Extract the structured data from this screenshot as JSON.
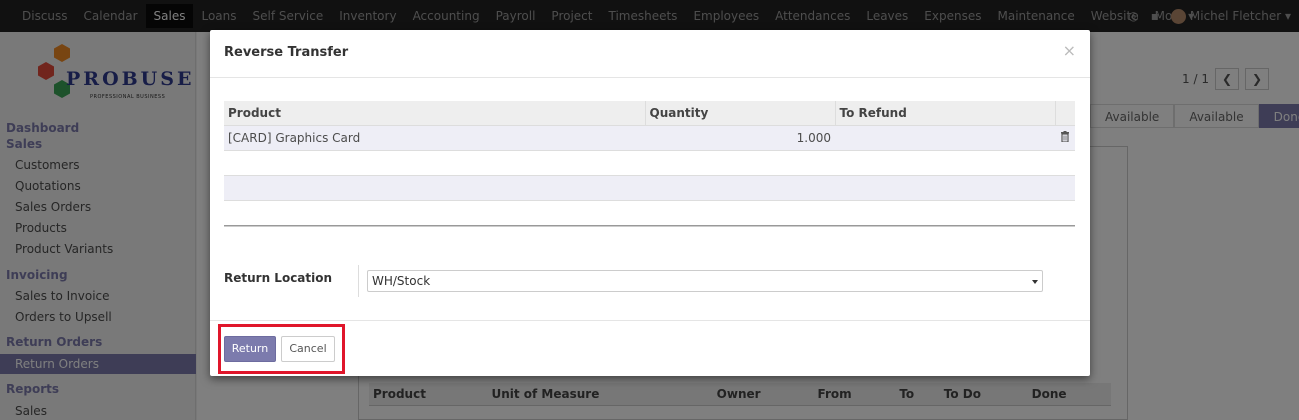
{
  "topbar": {
    "menu": [
      "Discuss",
      "Calendar",
      "Sales",
      "Loans",
      "Self Service",
      "Inventory",
      "Accounting",
      "Payroll",
      "Project",
      "Timesheets",
      "Employees",
      "Attendances",
      "Leaves",
      "Expenses",
      "Maintenance",
      "Website",
      "More ▾"
    ],
    "active": "Sales",
    "user": "Michel Fletcher ▾"
  },
  "logo": {
    "brand": "PROBUSE",
    "tagline": "PROFESSIONAL BUSINESS"
  },
  "sidebar": {
    "sections": [
      {
        "head": "Dashboard",
        "items": []
      },
      {
        "head": "Sales",
        "items": [
          "Customers",
          "Quotations",
          "Sales Orders",
          "Products",
          "Product Variants"
        ]
      },
      {
        "head": "Invoicing",
        "items": [
          "Sales to Invoice",
          "Orders to Upsell"
        ]
      },
      {
        "head": "Return Orders",
        "items": [
          "Return Orders"
        ]
      },
      {
        "head": "Reports",
        "items": [
          "Sales"
        ]
      }
    ],
    "active_item": "Return Orders"
  },
  "background": {
    "pager": "1 / 1",
    "status": [
      "Available",
      "Available",
      "Done"
    ],
    "table_headers": [
      "Product",
      "Unit of Measure",
      "Owner",
      "From",
      "To",
      "To Do",
      "Done"
    ]
  },
  "modal": {
    "title": "Reverse Transfer",
    "close": "×",
    "columns": [
      "Product",
      "Quantity",
      "To Refund"
    ],
    "rows": [
      {
        "product": "[CARD] Graphics Card",
        "quantity": "1.000",
        "to_refund": ""
      }
    ],
    "return_location_label": "Return Location",
    "return_location_value": "WH/Stock",
    "buttons": {
      "return": "Return",
      "cancel": "Cancel"
    },
    "highlight_color": "#e0162b",
    "accent_color": "#7c7bad"
  }
}
